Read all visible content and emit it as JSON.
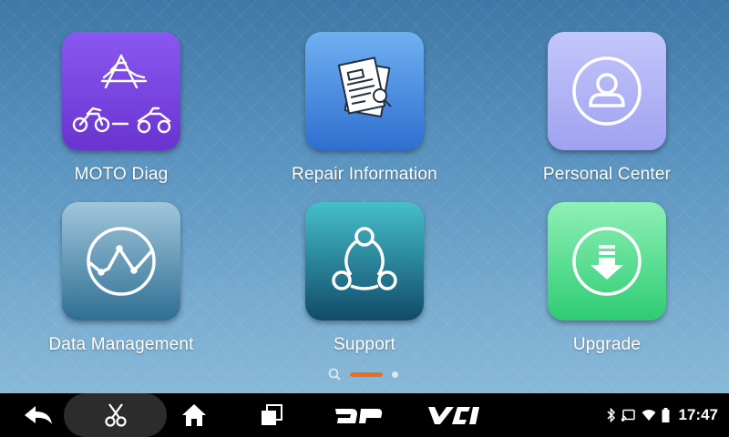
{
  "apps": [
    {
      "label": "MOTO Diag",
      "icon": "vehicle-triangle-icon",
      "color": "#7b45e6"
    },
    {
      "label": "Repair Information",
      "icon": "documents-magnifier-icon",
      "color": "#4a8de6"
    },
    {
      "label": "Personal Center",
      "icon": "user-profile-icon",
      "color": "#b0b2f6"
    },
    {
      "label": "Data Management",
      "icon": "line-chart-icon",
      "color": "#5d93b3"
    },
    {
      "label": "Support",
      "icon": "share-network-icon",
      "color": "#2a8a9f"
    },
    {
      "label": "Upgrade",
      "icon": "download-arrow-icon",
      "color": "#4ddc8c"
    }
  ],
  "pager": {
    "pages": 2,
    "current": 1,
    "accent": "#f26a1b"
  },
  "navbar": {
    "buttons": [
      "back-icon",
      "scissors-icon",
      "home-icon",
      "recent-apps-icon",
      "dp-icon",
      "vci-icon"
    ],
    "dp_text": "DP",
    "vci_text": "VCI"
  },
  "status": {
    "icons": [
      "bluetooth-icon",
      "cast-icon",
      "wifi-icon",
      "battery-icon"
    ],
    "time": "17:47"
  }
}
